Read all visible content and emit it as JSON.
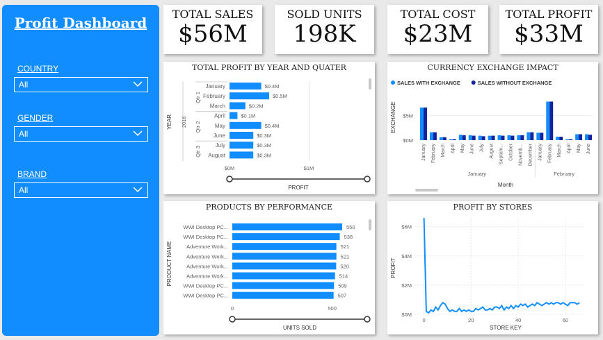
{
  "sidebar": {
    "title": "Profit Dashboard",
    "slicers": [
      {
        "label": "COUNTRY",
        "value": "All"
      },
      {
        "label": "GENDER",
        "value": "All"
      },
      {
        "label": "BRAND",
        "value": "All"
      }
    ]
  },
  "kpis": [
    {
      "label": "TOTAL SALES",
      "value": "$56M"
    },
    {
      "label": "SOLD UNITS",
      "value": "198K"
    },
    {
      "label": "TOTAL COST",
      "value": "$23M"
    },
    {
      "label": "TOTAL PROFIT",
      "value": "$33M"
    }
  ],
  "colors": {
    "accent": "#118dff",
    "dark_series": "#12239e",
    "text": "#605e5c"
  },
  "chart_data": [
    {
      "type": "bar",
      "title": "TOTAL PROFIT BY YEAR AND QUATER",
      "xlabel": "PROFIT",
      "ylabel": "YEAR",
      "year": "2016",
      "quarter_groups": [
        {
          "label": "Qtr 1",
          "months": [
            "January",
            "February",
            "March"
          ]
        },
        {
          "label": "Qtr 2",
          "months": [
            "April",
            "May",
            "June"
          ]
        },
        {
          "label": "Qtr 3",
          "months": [
            "July",
            "August"
          ]
        }
      ],
      "categories": [
        "January",
        "February",
        "March",
        "April",
        "May",
        "June",
        "July",
        "August"
      ],
      "values": [
        0.4,
        0.5,
        0.2,
        0.1,
        0.4,
        0.3,
        0.3,
        0.3
      ],
      "data_labels": [
        "$0.4M",
        "$0.5M",
        "$0.2M",
        "$0.1M",
        "$0.4M",
        "$0.3M",
        "$0.3M",
        "$0.3M"
      ],
      "xticks": [
        "$0M",
        "$1M"
      ],
      "xlim": [
        0,
        1
      ]
    },
    {
      "type": "bar",
      "title": "CURRENCY EXCHANGE IMPACT",
      "xlabel": "Month",
      "ylabel": "EXCHANGE",
      "legend_position": "top-left",
      "yticks": [
        "$0M",
        "$5M"
      ],
      "ylim": [
        0,
        8
      ],
      "categories": [
        "January",
        "February",
        "March",
        "April",
        "May",
        "June",
        "July",
        "August",
        "Septem...",
        "October",
        "Novemb...",
        "December",
        "January",
        "February",
        "March",
        "April",
        "May",
        "June"
      ],
      "groups": [
        "January",
        "February"
      ],
      "series": [
        {
          "name": "SALES WITH EXCHANGE",
          "values": [
            6.6,
            1.6,
            0.6,
            0.2,
            1.1,
            1.0,
            0.9,
            0.9,
            1.0,
            1.0,
            1.0,
            1.6,
            1.5,
            7.8,
            0.7,
            0.2,
            1.2,
            1.2
          ]
        },
        {
          "name": "SALES WITHOUT EXCHANGE",
          "values": [
            6.6,
            1.6,
            0.6,
            0.2,
            1.0,
            0.9,
            0.8,
            0.9,
            0.9,
            0.9,
            1.0,
            1.6,
            1.5,
            7.8,
            0.7,
            0.2,
            1.2,
            1.1
          ]
        }
      ]
    },
    {
      "type": "bar",
      "title": "PRODUCTS BY PERFORMANCE",
      "xlabel": "UNITS SOLD",
      "ylabel": "PRODUCT NAME",
      "categories": [
        "WWI Desktop PC...",
        "WWI Desktop PC...",
        "Adventure Work...",
        "Adventure Work...",
        "Adventure Work...",
        "Adventure Work...",
        "WWI Desktop PC...",
        "WWI Desktop PC..."
      ],
      "values": [
        550,
        538,
        521,
        521,
        520,
        514,
        509,
        507
      ],
      "data_labels": [
        "550",
        "538",
        "521",
        "521",
        "520",
        "514",
        "509",
        "507"
      ],
      "xticks": [
        "0",
        "500"
      ],
      "xlim": [
        0,
        550
      ]
    },
    {
      "type": "line",
      "title": "PROFIT BY STORES",
      "xlabel": "STORE KEY",
      "ylabel": "PROFIT",
      "xticks": [
        "0",
        "20",
        "40",
        "60"
      ],
      "yticks": [
        "$0M",
        "$2M",
        "$4M",
        "$6M"
      ],
      "xlim": [
        -4,
        68
      ],
      "ylim": [
        0,
        6.6
      ],
      "x": [
        0,
        1,
        2,
        3,
        4,
        5,
        6,
        7,
        8,
        9,
        10,
        11,
        12,
        13,
        14,
        15,
        16,
        17,
        18,
        19,
        20,
        21,
        22,
        23,
        24,
        25,
        26,
        27,
        28,
        29,
        30,
        31,
        32,
        33,
        34,
        35,
        36,
        37,
        38,
        39,
        40,
        41,
        42,
        43,
        44,
        45,
        46,
        47,
        48,
        49,
        50,
        51,
        52,
        53,
        54,
        55,
        56,
        57,
        58,
        59,
        60,
        61,
        62,
        63,
        64,
        65,
        66
      ],
      "y": [
        6.6,
        0.2,
        0.1,
        0.3,
        0.2,
        0.5,
        0.3,
        0.6,
        0.8,
        0.7,
        0.4,
        0.2,
        0.3,
        0.2,
        0.2,
        0.4,
        0.2,
        0.3,
        0.2,
        0.3,
        0.2,
        0.2,
        0.4,
        0.3,
        0.4,
        0.5,
        0.3,
        0.3,
        0.4,
        0.3,
        0.5,
        0.5,
        0.4,
        0.6,
        0.3,
        0.5,
        0.4,
        0.6,
        0.4,
        0.6,
        0.5,
        0.7,
        0.6,
        0.7,
        0.5,
        0.6,
        0.7,
        0.6,
        0.8,
        0.7,
        0.6,
        0.7,
        0.8,
        0.7,
        0.8,
        0.7,
        0.8,
        0.8,
        0.7,
        0.8,
        0.7,
        0.6,
        0.8,
        0.8,
        0.8,
        0.7,
        0.8
      ]
    }
  ]
}
